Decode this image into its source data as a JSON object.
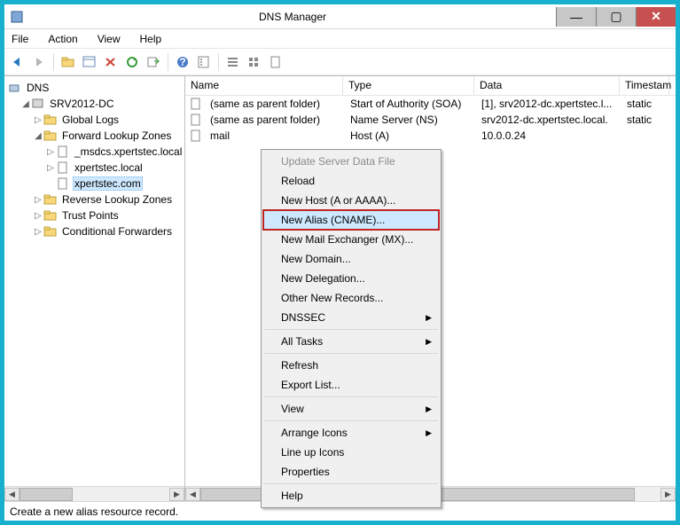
{
  "title": "DNS Manager",
  "window_buttons": {
    "min": "—",
    "max": "▢",
    "close": "✕"
  },
  "menubar": [
    "File",
    "Action",
    "View",
    "Help"
  ],
  "tree": {
    "root": "DNS",
    "server": "SRV2012-DC",
    "nodes": [
      "Global Logs",
      "Forward Lookup Zones",
      "_msdcs.xpertstec.local",
      "xpertstec.local",
      "xpertstec.com",
      "Reverse Lookup Zones",
      "Trust Points",
      "Conditional Forwarders"
    ]
  },
  "columns": {
    "name": "Name",
    "type": "Type",
    "data": "Data",
    "ts": "Timestam"
  },
  "rows": [
    {
      "name": "(same as parent folder)",
      "type": "Start of Authority (SOA)",
      "data": "[1], srv2012-dc.xpertstec.l...",
      "ts": "static"
    },
    {
      "name": "(same as parent folder)",
      "type": "Name Server (NS)",
      "data": "srv2012-dc.xpertstec.local.",
      "ts": "static"
    },
    {
      "name": "mail",
      "type": "Host (A)",
      "data": "10.0.0.24",
      "ts": ""
    }
  ],
  "context_menu": [
    {
      "label": "Update Server Data File",
      "disabled": true
    },
    {
      "label": "Reload"
    },
    {
      "label": "New Host (A or AAAA)..."
    },
    {
      "label": "New Alias (CNAME)...",
      "highlight": true
    },
    {
      "label": "New Mail Exchanger (MX)..."
    },
    {
      "label": "New Domain..."
    },
    {
      "label": "New Delegation..."
    },
    {
      "label": "Other New Records..."
    },
    {
      "label": "DNSSEC",
      "sub": true
    },
    {
      "sep": true
    },
    {
      "label": "All Tasks",
      "sub": true
    },
    {
      "sep": true
    },
    {
      "label": "Refresh"
    },
    {
      "label": "Export List..."
    },
    {
      "sep": true
    },
    {
      "label": "View",
      "sub": true
    },
    {
      "sep": true
    },
    {
      "label": "Arrange Icons",
      "sub": true
    },
    {
      "label": "Line up Icons"
    },
    {
      "label": "Properties"
    },
    {
      "sep": true
    },
    {
      "label": "Help"
    }
  ],
  "status": "Create a new alias resource record."
}
